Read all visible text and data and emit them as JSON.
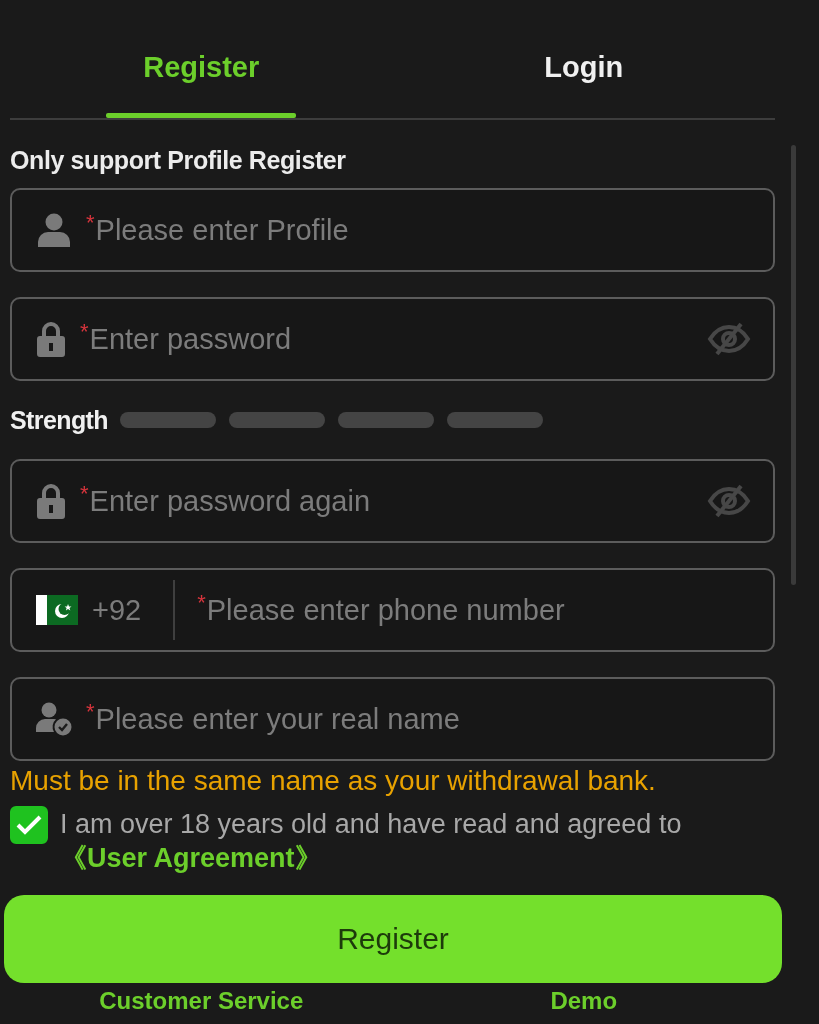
{
  "tabs": [
    {
      "label": "Register",
      "selected": true
    },
    {
      "label": "Login",
      "selected": false
    }
  ],
  "notice": "Only support Profile Register",
  "rows": [
    {
      "kind": "profile",
      "mark": "*",
      "placeholder": "Please enter Profile"
    },
    {
      "kind": "password",
      "mark": "*",
      "placeholder": "Enter password",
      "password_visible": false
    },
    {
      "kind": "strength",
      "label": "Strength",
      "segments": [
        {
          "filled": false
        },
        {
          "filled": false
        },
        {
          "filled": false
        },
        {
          "filled": false
        }
      ]
    },
    {
      "kind": "password",
      "mark": "*",
      "placeholder": "Enter password again",
      "password_visible": false
    },
    {
      "kind": "phone",
      "country_code": "+92",
      "mark": "*",
      "placeholder": "Please enter phone number"
    },
    {
      "kind": "name",
      "mark": "*",
      "placeholder": "Please enter your real name",
      "hint": "Must be in the same name as your withdrawal bank."
    }
  ],
  "agreement": {
    "checked": true,
    "text": "I am over 18 years old and have read and agreed to",
    "link": "《User Agreement》"
  },
  "submit": "Register",
  "footer_links": [
    "Customer Service",
    "Demo"
  ]
}
